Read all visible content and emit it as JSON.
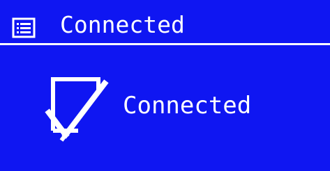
{
  "header": {
    "icon": "list-menu-icon",
    "title": "Connected"
  },
  "main": {
    "icon": "check-box-icon",
    "status": "Connected"
  },
  "colors": {
    "background": "#0f16f2",
    "foreground": "#ffffff"
  }
}
